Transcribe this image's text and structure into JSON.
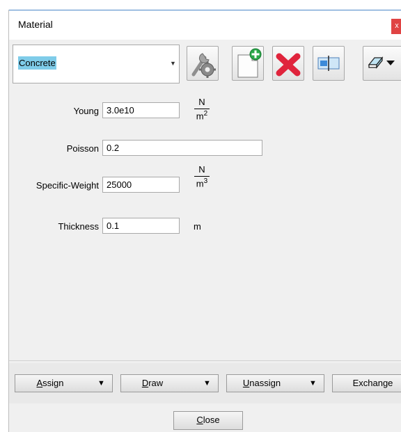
{
  "window": {
    "title": "Material",
    "close_glyph": "x"
  },
  "material": {
    "selected": "Concrete"
  },
  "toolbar": {
    "properties_icon": "wrench-gear-icon",
    "new_icon": "new-document-plus-icon",
    "delete_icon": "red-x-delete-icon",
    "rename_icon": "rename-field-icon",
    "menu_icon": "eraser-dropdown-icon"
  },
  "fields": {
    "young": {
      "label": "Young",
      "value": "3.0e10",
      "unit_num": "N",
      "unit_den": "m",
      "unit_exp": "2"
    },
    "poisson": {
      "label": "Poisson",
      "value": "0.2"
    },
    "specific_weight": {
      "label": "Specific-Weight",
      "value": "25000",
      "unit_num": "N",
      "unit_den": "m",
      "unit_exp": "3"
    },
    "thickness": {
      "label": "Thickness",
      "value": "0.1",
      "unit": "m"
    }
  },
  "bottom": {
    "assign": {
      "mnemonic": "A",
      "rest": "ssign"
    },
    "draw": {
      "mnemonic": "D",
      "rest": "raw"
    },
    "unassign": {
      "mnemonic": "U",
      "rest": "nassign"
    },
    "exchange": "Exchange",
    "close": {
      "mnemonic": "C",
      "rest": "lose"
    }
  },
  "colors": {
    "selection": "#7fcce9",
    "close_red": "#e04343",
    "delete_red": "#e0243c",
    "new_green": "#2aa84a"
  }
}
